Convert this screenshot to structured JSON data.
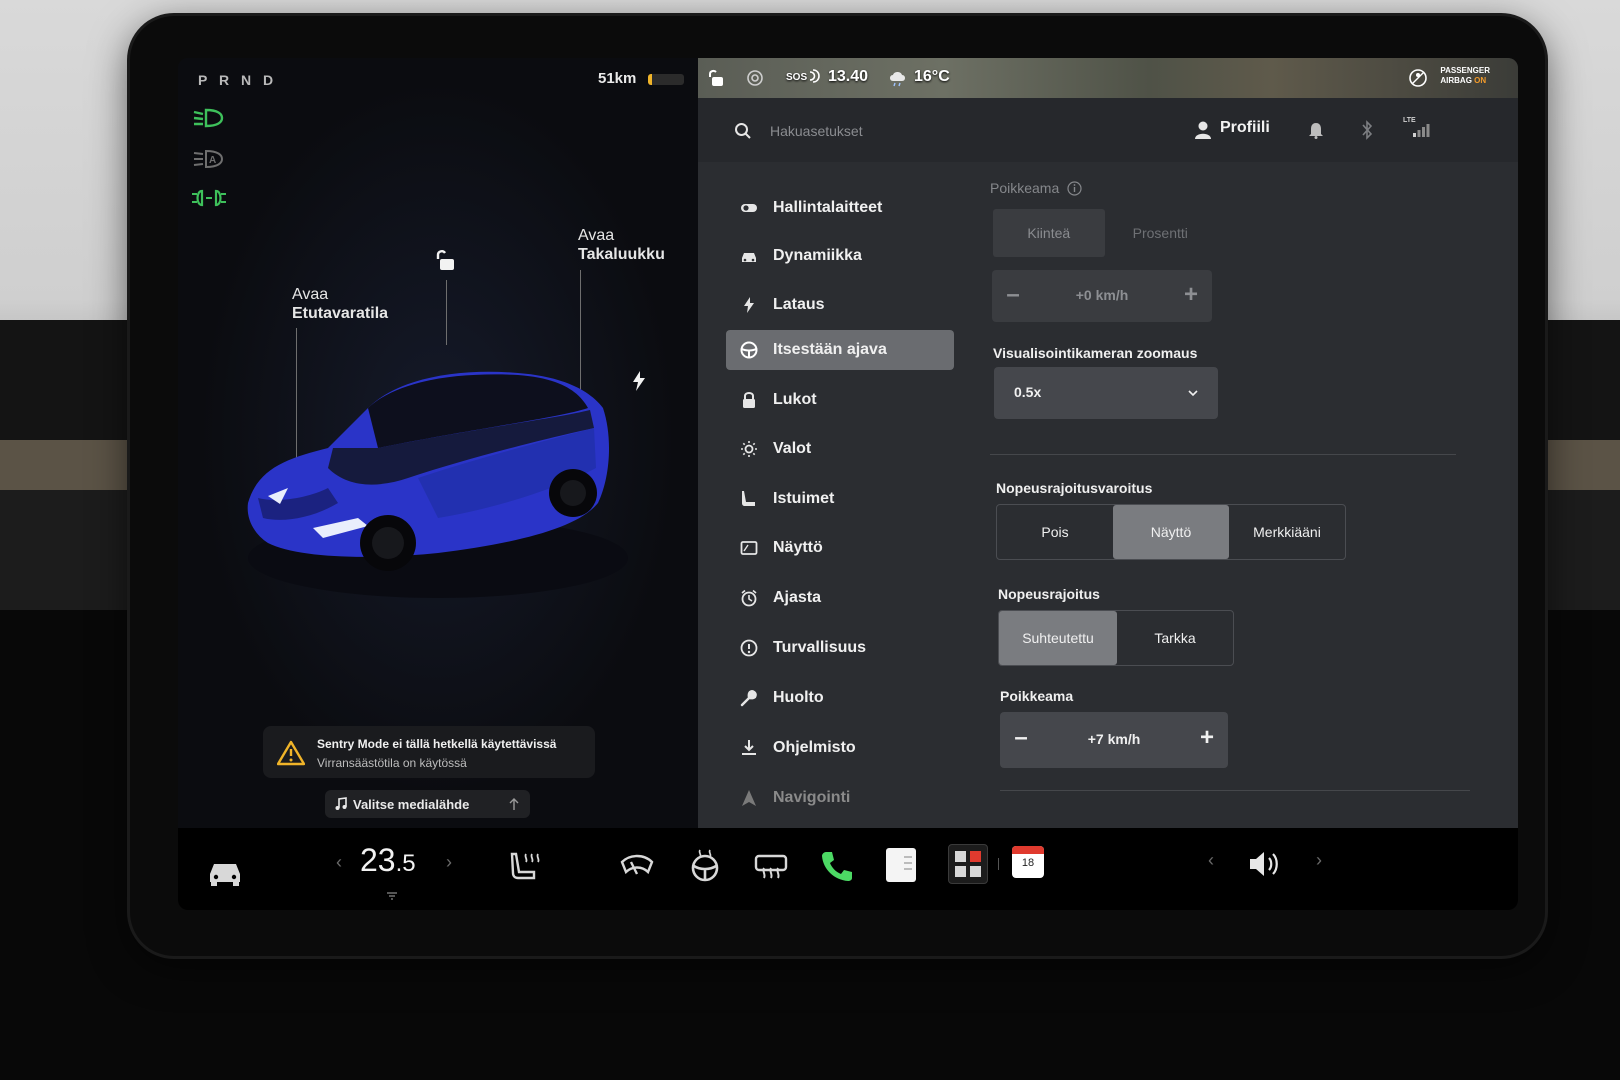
{
  "drive": {
    "gear_indicator": "P R N D",
    "range": "51km",
    "range_level_fraction": 0.12,
    "accent_color": "#f0b429",
    "telltale_color": "#3ec15b"
  },
  "car_view": {
    "frunk_line1": "Avaa",
    "frunk_line2": "Etutavaratila",
    "trunk_line1": "Avaa",
    "trunk_line2": "Takaluukku",
    "car_color": "#2a34c8"
  },
  "alert": {
    "title": "Sentry Mode ei tällä hetkellä käytettävissä",
    "subtitle": "Virransäästötila on käytössä"
  },
  "media": {
    "label": "Valitse medialähde"
  },
  "status": {
    "sos": "SOS",
    "time": "13.40",
    "weather": "16°C",
    "airbag_line1": "PASSENGER",
    "airbag_line2a": "AIRBAG",
    "airbag_line2b": "ON",
    "lte": "LTE"
  },
  "topbar": {
    "search_placeholder": "Hakuasetukset",
    "profile_label": "Profiili"
  },
  "nav": {
    "items": [
      {
        "label": "Hallintalaitteet",
        "icon": "toggle-icon"
      },
      {
        "label": "Dynamiikka",
        "icon": "car-icon"
      },
      {
        "label": "Lataus",
        "icon": "bolt-icon"
      },
      {
        "label": "Itsestään ajava",
        "icon": "steering-wheel-icon"
      },
      {
        "label": "Lukot",
        "icon": "lock-icon"
      },
      {
        "label": "Valot",
        "icon": "sun-icon"
      },
      {
        "label": "Istuimet",
        "icon": "seat-icon"
      },
      {
        "label": "Näyttö",
        "icon": "display-icon"
      },
      {
        "label": "Ajasta",
        "icon": "alarm-clock-icon"
      },
      {
        "label": "Turvallisuus",
        "icon": "info-circle-icon"
      },
      {
        "label": "Huolto",
        "icon": "wrench-icon"
      },
      {
        "label": "Ohjelmisto",
        "icon": "download-icon"
      },
      {
        "label": "Navigointi",
        "icon": "navigation-arrow-icon"
      }
    ],
    "active_index": 3
  },
  "settings": {
    "offset_top": {
      "label": "Poikkeama",
      "options": [
        "Kiinteä",
        "Prosentti"
      ],
      "selected": 0,
      "value": "+0 km/h"
    },
    "camera_zoom": {
      "label": "Visualisointikameran zoomaus",
      "value": "0.5x"
    },
    "speed_limit_warning": {
      "label": "Nopeusrajoitusvaroitus",
      "options": [
        "Pois",
        "Näyttö",
        "Merkkiääni"
      ],
      "selected": 1
    },
    "speed_limit": {
      "label": "Nopeusrajoitus",
      "options": [
        "Suhteutettu",
        "Tarkka"
      ],
      "selected": 0
    },
    "offset_bottom": {
      "label": "Poikkeama",
      "value": "+7 km/h"
    }
  },
  "dock": {
    "temp_whole": "23",
    "temp_decimal": ".5",
    "calendar_day": "18",
    "phone_color": "#4cd964"
  }
}
